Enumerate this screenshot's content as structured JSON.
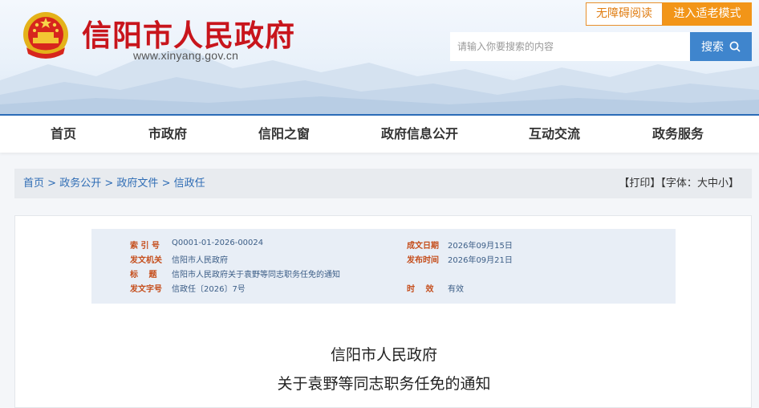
{
  "header": {
    "site_title": "信阳市人民政府",
    "site_url": "www.xinyang.gov.cn",
    "accessibility_label": "无障碍阅读",
    "elder_mode_label": "进入适老模式",
    "search_placeholder": "请输入你要搜索的内容",
    "search_button": "搜索"
  },
  "nav": {
    "items": [
      {
        "label": "首页"
      },
      {
        "label": "市政府"
      },
      {
        "label": "信阳之窗"
      },
      {
        "label": "政府信息公开"
      },
      {
        "label": "互动交流"
      },
      {
        "label": "政务服务"
      }
    ]
  },
  "breadcrumb": {
    "items": [
      "首页",
      "政务公开",
      "政府文件",
      "信政任"
    ],
    "separator": ">",
    "print_label": "【打印】",
    "font_label": "【字体：",
    "font_sizes": [
      "大",
      "中",
      "小"
    ],
    "font_close": "】"
  },
  "meta": {
    "index_label": "索 引 号",
    "index_value": "Q0001-01-2026-00024",
    "issuer_label": "发文机关",
    "issuer_value": "信阳市人民政府",
    "title_label": "标　 题",
    "title_value": "信阳市人民政府关于袁野等同志职务任免的通知",
    "docno_label": "发文字号",
    "docno_value": "信政任〔2026〕7号",
    "created_label": "成文日期",
    "created_value": "2026年09月15日",
    "published_label": "发布时间",
    "published_value": "2026年09月21日",
    "validity_label": "时　 效",
    "validity_value": "有效"
  },
  "document": {
    "title_line1": "信阳市人民政府",
    "title_line2": "关于袁野等同志职务任免的通知"
  },
  "colors": {
    "brand_red": "#c8151c",
    "nav_blue": "#2b6cb8",
    "search_blue": "#3f85cd",
    "orange": "#f29518"
  }
}
